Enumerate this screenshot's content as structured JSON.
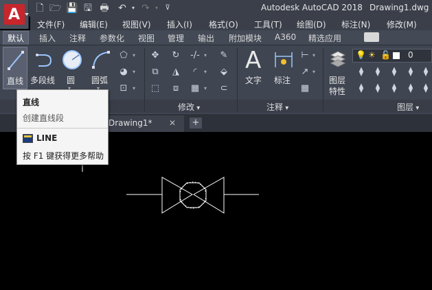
{
  "app": {
    "title": "Autodesk AutoCAD 2018",
    "document": "Drawing1.dwg",
    "logo_letter": "A"
  },
  "menu": [
    "文件(F)",
    "编辑(E)",
    "视图(V)",
    "插入(I)",
    "格式(O)",
    "工具(T)",
    "绘图(D)",
    "标注(N)",
    "修改(M)"
  ],
  "ribbon_tabs": [
    "默认",
    "插入",
    "注释",
    "参数化",
    "视图",
    "管理",
    "输出",
    "附加模块",
    "A360",
    "精选应用"
  ],
  "tools": {
    "line": "直线",
    "polyline": "多段线",
    "circle": "圆",
    "arc": "圆弧",
    "text": "文字",
    "dimension": "标注",
    "layer_properties_1": "图层",
    "layer_properties_2": "特性"
  },
  "layer_value": "0",
  "panels": {
    "modify": "修改",
    "annotation": "注释",
    "layers": "图层"
  },
  "tooltip": {
    "title": "直线",
    "description": "创建直线段",
    "command": "LINE",
    "help": "按 F1 键获得更多帮助"
  },
  "doc_tab": "Drawing1*",
  "colors": {
    "accent": "#c8262c",
    "ribbon_bg": "#3f4551",
    "canvas_bg": "#000000"
  }
}
